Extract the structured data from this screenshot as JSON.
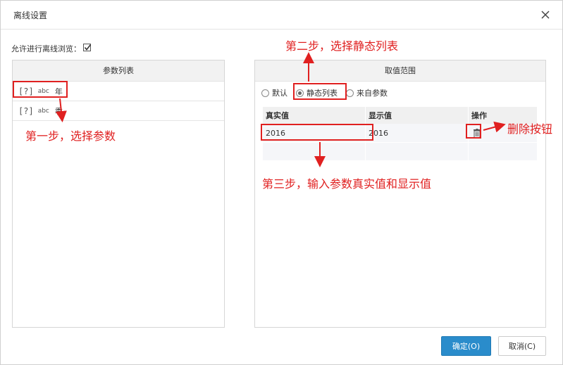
{
  "dialog": {
    "title": "离线设置",
    "allow_offline_label": "允许进行离线浏览："
  },
  "param_list": {
    "header": "参数列表",
    "items": [
      {
        "qicon": "[?]",
        "type": "abc",
        "name": "年"
      },
      {
        "qicon": "[?]",
        "type": "abc",
        "name": "季"
      }
    ]
  },
  "value_range": {
    "header": "取值范围",
    "options": [
      "默认",
      "静态列表",
      "来自参数"
    ],
    "selected_option": "静态列表",
    "columns": [
      "真实值",
      "显示值",
      "操作"
    ],
    "rows": [
      {
        "real": "2016",
        "display": "2016"
      }
    ]
  },
  "buttons": {
    "ok": "确定(O)",
    "cancel": "取消(C)"
  },
  "annotations": {
    "step1": "第一步，选择参数",
    "step2": "第二步，选择静态列表",
    "step3": "第三步，输入参数真实值和显示值",
    "delete": "删除按钮"
  },
  "colors": {
    "annotation_red": "#e02020",
    "primary_button": "#2a8ccb"
  },
  "icons": {
    "close": "close-icon",
    "checkbox": "checkbox-checked-icon",
    "param": "unknown-param-icon",
    "delete": "trash-icon"
  }
}
